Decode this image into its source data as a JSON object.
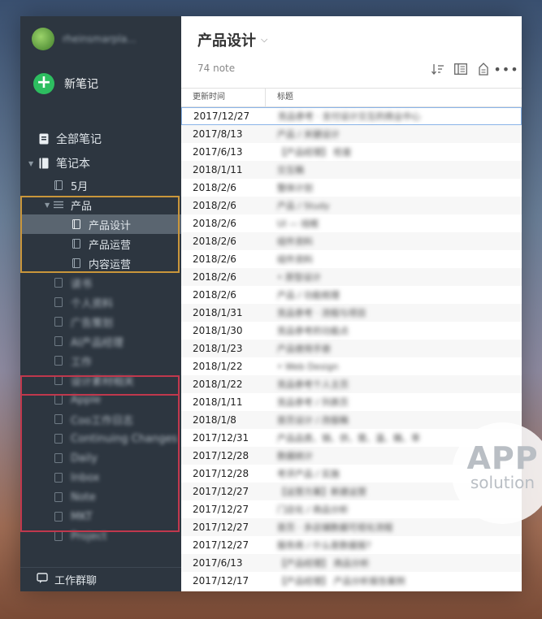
{
  "sidebar": {
    "account_name": "rheinsmarpla...",
    "new_note_label": "新笔记",
    "all_notes_label": "全部笔记",
    "notebooks_label": "笔记本",
    "notebooks": [
      {
        "label": "5月"
      },
      {
        "label": "产品",
        "children": [
          {
            "label": "产品设计",
            "selected": true
          },
          {
            "label": "产品运营"
          },
          {
            "label": "内容运营"
          }
        ]
      },
      {
        "label": "读书"
      },
      {
        "label": "个人资料"
      },
      {
        "label": "广告策划"
      },
      {
        "label": "AI产品经理"
      },
      {
        "label": "工作"
      },
      {
        "label": "设计素材相关"
      },
      {
        "label": "Apple"
      },
      {
        "label": "Coo工作日志"
      },
      {
        "label": "Continuing Changes"
      },
      {
        "label": "Daily"
      },
      {
        "label": "Inbox"
      },
      {
        "label": "Note"
      },
      {
        "label": "MKT"
      },
      {
        "label": "Project"
      }
    ],
    "bottom_label": "工作群聊"
  },
  "main": {
    "notebook_title": "产品设计",
    "note_count": "74 note",
    "columns": {
      "updated": "更新时间",
      "title": "标题"
    },
    "rows": [
      {
        "date": "2017/12/27",
        "title": "竞品参考 · 支付设计交互的商业中心"
      },
      {
        "date": "2017/8/13",
        "title": "产品 / 关键设计"
      },
      {
        "date": "2017/6/13",
        "title": "【产品经理】 检查"
      },
      {
        "date": "2018/1/11",
        "title": "交互稿"
      },
      {
        "date": "2018/2/6",
        "title": "整体计划"
      },
      {
        "date": "2018/2/6",
        "title": "产品 / Study"
      },
      {
        "date": "2018/2/6",
        "title": "UI — 线框"
      },
      {
        "date": "2018/2/6",
        "title": "组件资料"
      },
      {
        "date": "2018/2/6",
        "title": "组件资料"
      },
      {
        "date": "2018/2/6",
        "title": "• 原型设计"
      },
      {
        "date": "2018/2/6",
        "title": "产品 / 功能梳理"
      },
      {
        "date": "2018/1/31",
        "title": "竞品参考 · 流程与项目"
      },
      {
        "date": "2018/1/30",
        "title": "竞品参考的功能点"
      },
      {
        "date": "2018/1/23",
        "title": "产品使用手册"
      },
      {
        "date": "2018/1/22",
        "title": "• Web Design"
      },
      {
        "date": "2018/1/22",
        "title": "竞品参考个人主页"
      },
      {
        "date": "2018/1/11",
        "title": "竞品参考 / 列表页"
      },
      {
        "date": "2018/1/8",
        "title": "首页设计 / 改版稿"
      },
      {
        "date": "2017/12/31",
        "title": "产品品类、销、供、需、温、稿、率"
      },
      {
        "date": "2017/12/28",
        "title": "数据统计"
      },
      {
        "date": "2017/12/28",
        "title": "考评产品 / 实施"
      },
      {
        "date": "2017/12/27",
        "title": "【运营方案】新建运营"
      },
      {
        "date": "2017/12/27",
        "title": "门店化 / 商品分析"
      },
      {
        "date": "2017/12/27",
        "title": "首页 · 多店铺数据可视化流程"
      },
      {
        "date": "2017/12/27",
        "title": "服务商 / 什么是数据报?"
      },
      {
        "date": "2017/6/13",
        "title": "【产品经理】 商品分析"
      },
      {
        "date": "2017/12/17",
        "title": "【产品经理】 产品分析报告案例"
      }
    ]
  },
  "watermark": {
    "line1": "APP",
    "line2": "solution"
  },
  "colors": {
    "sidebar_bg": "#2d3640",
    "accent_green": "#2dbe60",
    "highlight_orange": "#c9963b",
    "highlight_red": "#c0384d"
  }
}
